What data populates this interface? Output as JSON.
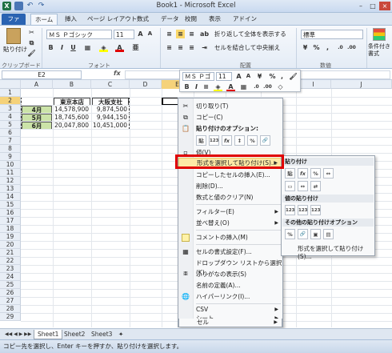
{
  "window": {
    "title": "Book1 - Microsoft Excel"
  },
  "ribbon_tabs": [
    "ファイル",
    "ホーム",
    "挿入",
    "ページ レイアウト",
    "数式",
    "データ",
    "校閲",
    "表示",
    "アドイン"
  ],
  "ribbon": {
    "clipboard": {
      "paste_label": "貼り付け",
      "group_label": "クリップボード"
    },
    "font": {
      "name": "ＭＳ Ｐゴシック",
      "size": "11",
      "group_label": "フォント"
    },
    "alignment": {
      "wrap_label": "折り返して全体を表示する",
      "merge_label": "セルを結合して中央揃え",
      "group_label": "配置"
    },
    "number": {
      "format": "標準",
      "group_label": "数値"
    },
    "styles": {
      "cond_label": "条件付き書式"
    }
  },
  "formula_bar": {
    "name_box": "E2",
    "fx": "fx"
  },
  "columns": [
    "A",
    "B",
    "C",
    "D",
    "E",
    "F",
    "G",
    "H",
    "I",
    "J"
  ],
  "rows": [
    "1",
    "2",
    "3",
    "4",
    "5",
    "6",
    "7",
    "8",
    "9",
    "10",
    "11",
    "12",
    "13",
    "14",
    "15",
    "16",
    "17",
    "18",
    "19",
    "20",
    "21",
    "22",
    "23",
    "24",
    "25",
    "26",
    "27",
    "28",
    "29"
  ],
  "table": {
    "headers": [
      "東京本店",
      "大阪支社"
    ],
    "rows": [
      {
        "label": "4月",
        "b": "14,578,900",
        "c": "9,874,500"
      },
      {
        "label": "5月",
        "b": "18,745,600",
        "c": "9,944,150"
      },
      {
        "label": "6月",
        "b": "20,047,800",
        "c": "10,451,000"
      }
    ]
  },
  "mini_toolbar": {
    "font": "ＭＳ Ｐゴ",
    "size": "11"
  },
  "context_menu": {
    "cut": "切り取り(T)",
    "copy": "コピー(C)",
    "paste_options": "貼り付けのオプション:",
    "paste_buttons": [
      "貼",
      "123",
      "fx",
      "↕",
      "%",
      "🔗"
    ],
    "value": "値(V)",
    "paste_special": "形式を選択して貼り付け(S)...",
    "insert_copied": "コピーしたセルの挿入(E)...",
    "delete": "削除(D)...",
    "clear": "数式と値のクリア(N)",
    "filter": "フィルター(E)",
    "sort": "並べ替え(O)",
    "insert_comment": "コメントの挿入(M)",
    "format_cells": "セルの書式設定(F)...",
    "dropdown": "ドロップダウン リストから選択(K)...",
    "phonetic": "ふりがなの表示(S)",
    "define_name": "名前の定義(A)...",
    "hyperlink": "ハイパーリンク(I)...",
    "csv": "CSV",
    "sheet": "シート",
    "cell": "セル"
  },
  "submenu": {
    "paste": "貼り付け",
    "paste_buttons": [
      "貼",
      "fx",
      "%",
      "↔"
    ],
    "values_paste": "値の貼り付け",
    "values_buttons": [
      "123",
      "123",
      "123"
    ],
    "other_paste": "その他の貼り付けオプション",
    "other_buttons": [
      "%",
      "🔗",
      "▣",
      "▤"
    ],
    "paste_special": "形式を選択して貼り付け(S)..."
  },
  "sheet_tabs": [
    "Sheet1",
    "Sheet2",
    "Sheet3"
  ],
  "status": "コピー先を選択し、Enter キーを押すか、貼り付けを選択します。"
}
